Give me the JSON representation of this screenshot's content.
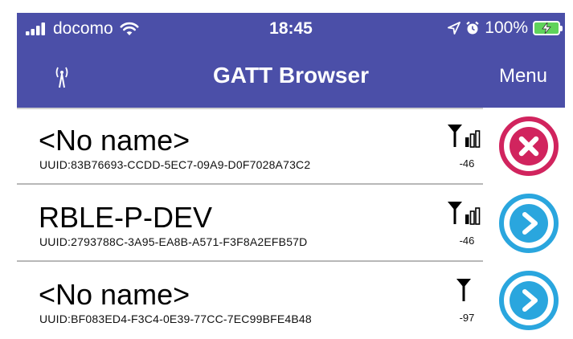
{
  "status": {
    "carrier": "docomo",
    "time": "18:45",
    "battery": "100%"
  },
  "nav": {
    "title": "GATT Browser",
    "menu_label": "Menu",
    "left_icon": "antenna-icon"
  },
  "devices": [
    {
      "name": "<No name>",
      "uuid": "UUID:83B76693-CCDD-5EC7-09A9-D0F7028A73C2",
      "rssi": "-46",
      "signal_bars": 3,
      "action": "disconnect"
    },
    {
      "name": "RBLE-P-DEV",
      "uuid": "UUID:2793788C-3A95-EA8B-A571-F3F8A2EFB57D",
      "rssi": "-46",
      "signal_bars": 3,
      "action": "connect"
    },
    {
      "name": "<No name>",
      "uuid": "UUID:BF083ED4-F3C4-0E39-77CC-7EC99BFE4B48",
      "rssi": "-97",
      "signal_bars": 0,
      "action": "connect"
    }
  ],
  "colors": {
    "nav_bar": "#4b4fa8",
    "disconnect": "#d1245e",
    "connect": "#2aa6de",
    "battery_fill": "#5fd35b"
  }
}
